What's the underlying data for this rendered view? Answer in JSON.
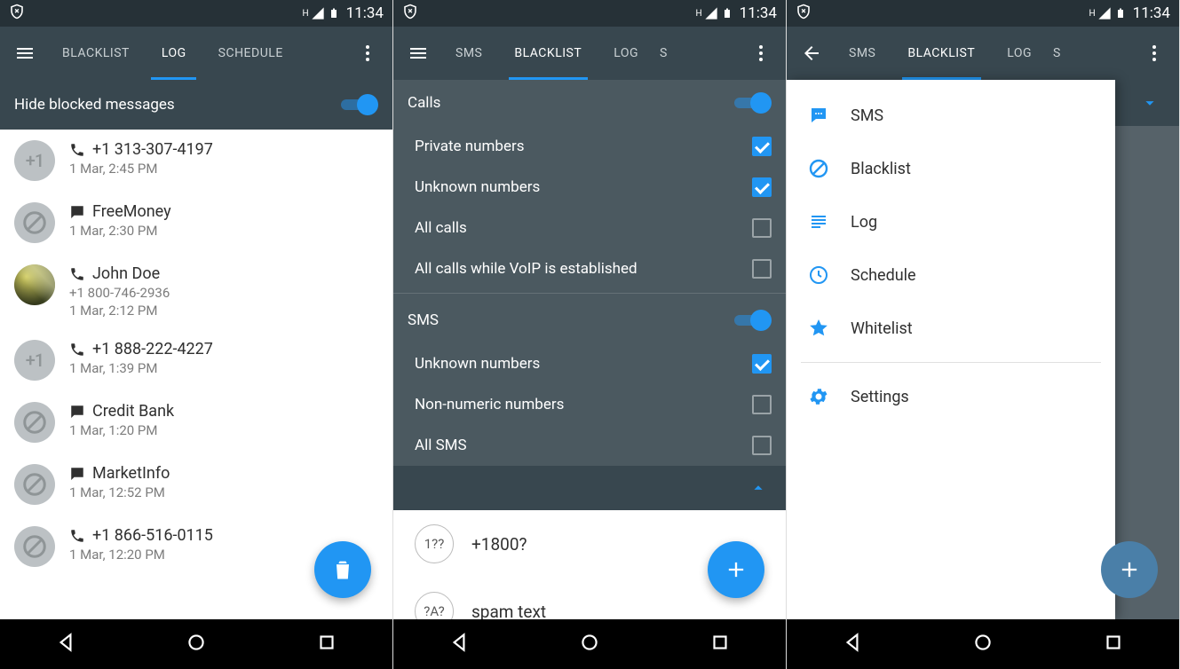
{
  "status": {
    "time": "11:34",
    "indicator": "H"
  },
  "screen1": {
    "tabs": [
      "BLACKLIST",
      "LOG",
      "SCHEDULE"
    ],
    "activeTab": 1,
    "hideBlockedLabel": "Hide blocked messages",
    "log": [
      {
        "type": "call",
        "avatar": "num",
        "title": "+1 313-307-4197",
        "sub": "1 Mar, 2:45 PM"
      },
      {
        "type": "sms",
        "avatar": "block",
        "title": "FreeMoney",
        "sub": "1 Mar, 2:30 PM"
      },
      {
        "type": "call",
        "avatar": "photo",
        "title": "John Doe",
        "sub": "+1 800-746-2936",
        "sub2": "1 Mar, 2:12 PM"
      },
      {
        "type": "call",
        "avatar": "num",
        "title": "+1 888-222-4227",
        "sub": "1 Mar, 1:39 PM"
      },
      {
        "type": "sms",
        "avatar": "block",
        "title": "Credit Bank",
        "sub": "1 Mar, 1:20 PM"
      },
      {
        "type": "sms",
        "avatar": "block",
        "title": "MarketInfo",
        "sub": "1 Mar, 12:52 PM"
      },
      {
        "type": "call",
        "avatar": "block",
        "title": "+1 866-516-0115",
        "sub": "1 Mar, 12:20 PM"
      }
    ]
  },
  "screen2": {
    "tabs": [
      "SMS",
      "BLACKLIST",
      "LOG",
      "S"
    ],
    "activeTab": 1,
    "callSection": {
      "title": "Calls",
      "options": [
        {
          "label": "Private numbers",
          "checked": true
        },
        {
          "label": "Unknown numbers",
          "checked": true
        },
        {
          "label": "All calls",
          "checked": false
        },
        {
          "label": "All calls while VoIP is established",
          "checked": false
        }
      ]
    },
    "smsSection": {
      "title": "SMS",
      "options": [
        {
          "label": "Unknown numbers",
          "checked": true
        },
        {
          "label": "Non-numeric numbers",
          "checked": false
        },
        {
          "label": "All SMS",
          "checked": false
        }
      ]
    },
    "blacklist": [
      {
        "badge": "1??",
        "label": "+1800?"
      },
      {
        "badge": "?A?",
        "label": "spam text"
      }
    ]
  },
  "screen3": {
    "tabs": [
      "SMS",
      "BLACKLIST",
      "LOG",
      "S"
    ],
    "activeTab": 1,
    "drawer": [
      {
        "icon": "sms",
        "label": "SMS"
      },
      {
        "icon": "block",
        "label": "Blacklist"
      },
      {
        "icon": "log",
        "label": "Log"
      },
      {
        "icon": "schedule",
        "label": "Schedule"
      },
      {
        "icon": "star",
        "label": "Whitelist"
      },
      {
        "divider": true
      },
      {
        "icon": "settings",
        "label": "Settings"
      }
    ]
  }
}
